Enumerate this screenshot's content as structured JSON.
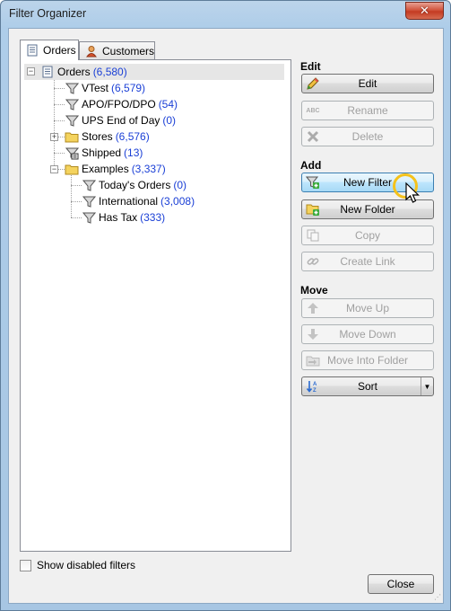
{
  "window": {
    "title": "Filter Organizer",
    "close_glyph": "✕"
  },
  "tabs": [
    {
      "label": "Orders",
      "icon": "orders-icon",
      "active": true
    },
    {
      "label": "Customers",
      "icon": "customer-person-icon",
      "active": false
    }
  ],
  "tree": {
    "root": {
      "label": "Orders",
      "count": "(6,580)"
    },
    "items": [
      {
        "label": "VTest",
        "count": "(6,579)",
        "icon": "filter-funnel-icon"
      },
      {
        "label": "APO/FPO/DPO",
        "count": "(54)",
        "icon": "filter-funnel-icon"
      },
      {
        "label": "UPS End of Day",
        "count": "(0)",
        "icon": "filter-funnel-icon"
      },
      {
        "label": "Stores",
        "count": "(6,576)",
        "icon": "folder-icon"
      },
      {
        "label": "Shipped",
        "count": "(13)",
        "icon": "shipped-filter-icon"
      },
      {
        "label": "Examples",
        "count": "(3,337)",
        "icon": "folder-icon"
      },
      {
        "label": "Today's Orders",
        "count": "(0)",
        "icon": "filter-funnel-icon"
      },
      {
        "label": "International",
        "count": "(3,008)",
        "icon": "filter-funnel-icon"
      },
      {
        "label": "Has Tax",
        "count": "(333)",
        "icon": "filter-funnel-icon"
      }
    ]
  },
  "sections": {
    "edit": "Edit",
    "add": "Add",
    "move": "Move"
  },
  "buttons": {
    "edit": "Edit",
    "rename": "Rename",
    "delete": "Delete",
    "new_filter": "New Filter",
    "new_folder": "New Folder",
    "copy": "Copy",
    "create_link": "Create Link",
    "move_up": "Move Up",
    "move_down": "Move Down",
    "move_into_folder": "Move Into Folder",
    "sort": "Sort",
    "close": "Close"
  },
  "show_disabled_filters": {
    "label": "Show disabled filters",
    "checked": false
  },
  "colors": {
    "count_text": "#1a3fd6",
    "hover_highlight": "#a7d9f5",
    "cursor_ring": "#f5c21b"
  }
}
